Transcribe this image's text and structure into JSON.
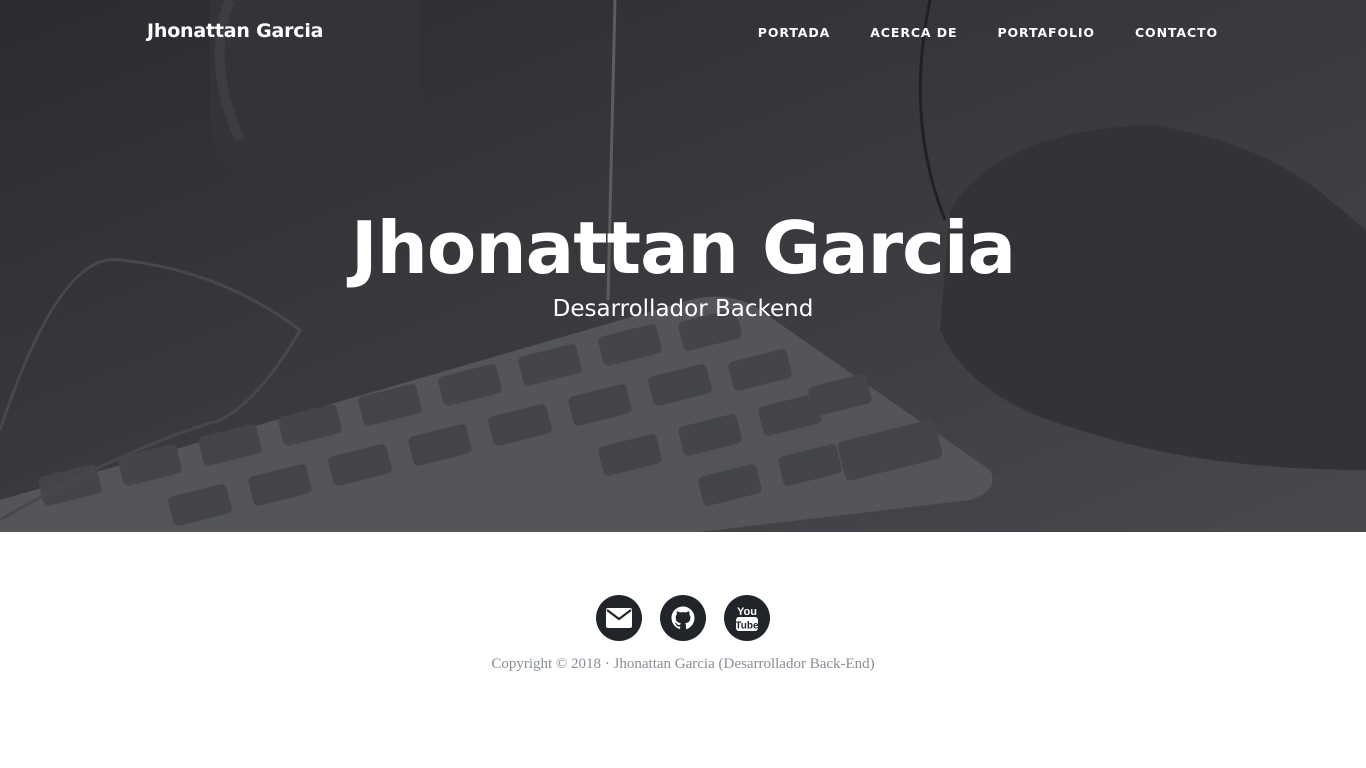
{
  "navbar": {
    "brand": "Jhonattan Garcia",
    "links": [
      "PORTADA",
      "ACERCA DE",
      "PORTAFOLIO",
      "CONTACTO"
    ]
  },
  "hero": {
    "title": "Jhonattan Garcia",
    "subtitle": "Desarrollador Backend"
  },
  "footer": {
    "social": [
      {
        "icon": "envelope-icon"
      },
      {
        "icon": "github-icon"
      },
      {
        "icon": "youtube-icon"
      }
    ],
    "copyright": "Copyright © 2018 · Jhonattan Garcia (Desarrollador Back-End)"
  },
  "colors": {
    "social_bg": "#212529",
    "copyright_text": "#868e96"
  }
}
